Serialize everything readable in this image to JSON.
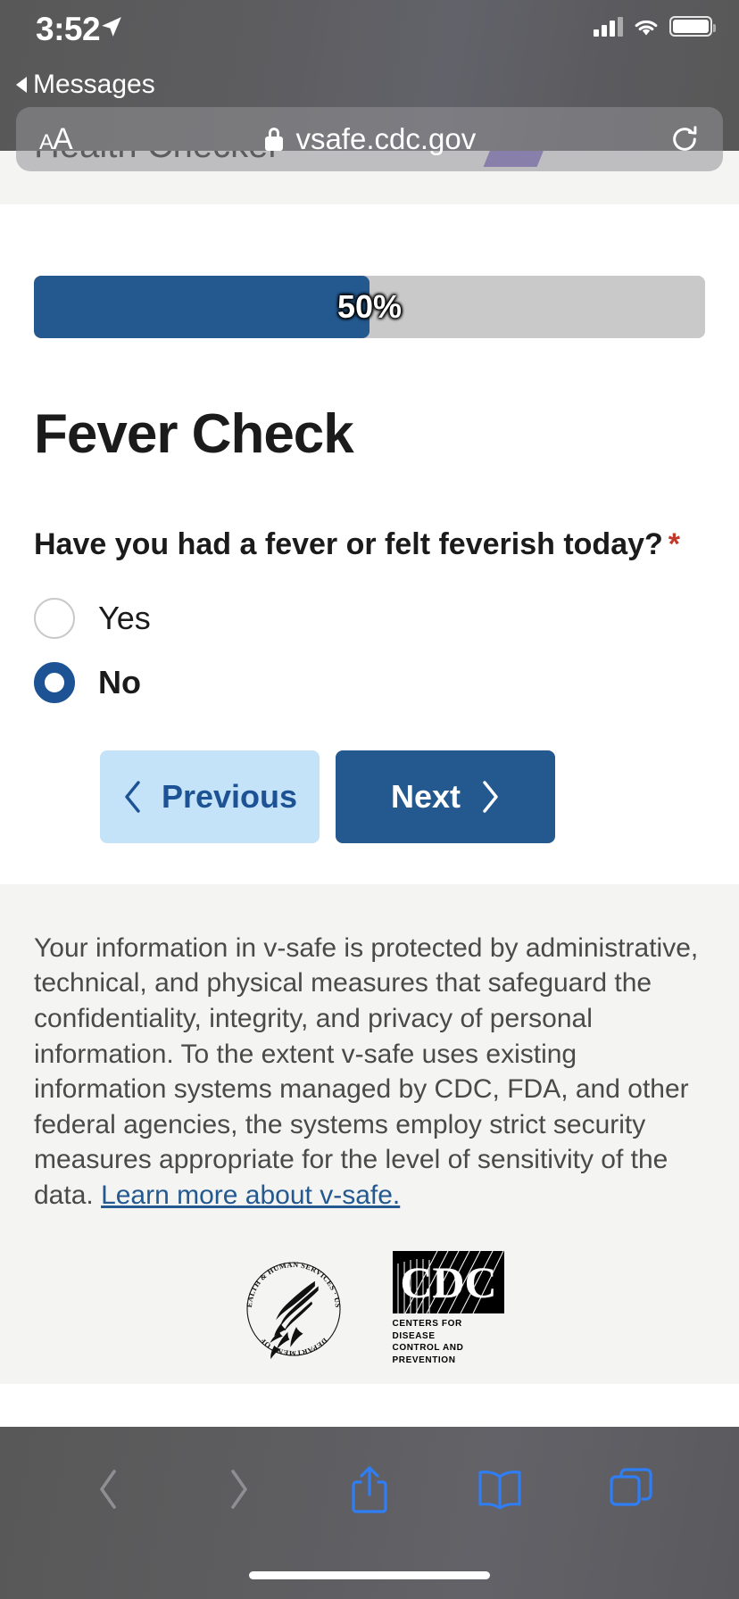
{
  "status_bar": {
    "time": "3:52",
    "location_icon": "location-arrow-icon",
    "back_label": "Messages",
    "signal_icon": "cellular-signal-icon",
    "wifi_icon": "wifi-icon",
    "battery_icon": "battery-icon"
  },
  "browser": {
    "text_size_small": "A",
    "text_size_large": "A",
    "lock_icon": "lock-icon",
    "url": "vsafe.cdc.gov",
    "reload_icon": "reload-icon"
  },
  "app_header": {
    "title": "Health Checker"
  },
  "progress": {
    "label": "50%",
    "percent": 50,
    "fill_color": "#24598f",
    "track_color": "#c9c9c9"
  },
  "form": {
    "section_title": "Fever Check",
    "question": "Have you had a fever or felt feverish today?",
    "required_marker": "*",
    "options": [
      {
        "label": "Yes",
        "selected": false
      },
      {
        "label": "No",
        "selected": true
      }
    ]
  },
  "nav": {
    "previous_label": "Previous",
    "next_label": "Next",
    "prev_icon": "chevron-left-icon",
    "next_icon": "chevron-right-icon",
    "prev_bg": "#c5e3f8",
    "next_bg": "#24598f"
  },
  "footer": {
    "paragraph": "Your information in v-safe is protected by administrative, technical, and physical measures that safeguard the confidentiality, integrity, and privacy of personal information. To the extent v-safe uses existing information systems managed by CDC, FDA, and other federal agencies, the systems employ strict security measures appropriate for the level of sensitivity of the data. ",
    "link_text": "Learn more about v-safe.",
    "hhs_seal": "hhs-department-seal",
    "cdc_wordmark": "CDC",
    "cdc_sub_line1": "CENTERS  FOR  DISEASE",
    "cdc_sub_line2": "CONTROL AND PREVENTION"
  },
  "toolbar": {
    "back_icon": "chevron-left-icon",
    "forward_icon": "chevron-right-icon",
    "share_icon": "share-icon",
    "bookmarks_icon": "book-icon",
    "tabs_icon": "tabs-icon"
  }
}
